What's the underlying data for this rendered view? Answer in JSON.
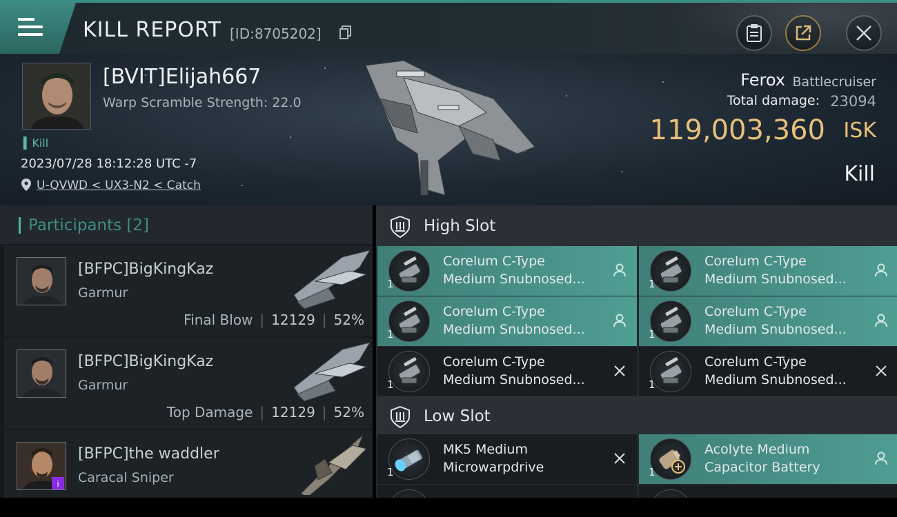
{
  "topbar": {
    "title": "KILL REPORT",
    "report_id": "[ID:8705202]",
    "icons": [
      "menu-icon",
      "clipboard-icon",
      "share-icon",
      "close-icon"
    ]
  },
  "victim": {
    "name": "[BVIT]Elijah667",
    "warp_scramble": "Warp Scramble Strength: 22.0",
    "tag": "Kill",
    "datetime": "2023/07/28 18:12:28 UTC -7",
    "location": "U-QVWD < UX3-N2 < Catch",
    "ship_name": "Ferox",
    "ship_class": "Battlecruiser",
    "total_damage_label": "Total damage:",
    "total_damage": "23094",
    "isk_value": "119,003,360",
    "isk_unit": "ISK",
    "result": "Kill"
  },
  "participants": {
    "label": "Participants",
    "count": "[2]",
    "rows": [
      {
        "name": "[BFPC]BigKingKaz",
        "ship": "Garmur",
        "role": "Final Blow",
        "damage": "12129",
        "percent": "52%"
      },
      {
        "name": "[BFPC]BigKingKaz",
        "ship": "Garmur",
        "role": "Top Damage",
        "damage": "12129",
        "percent": "52%"
      },
      {
        "name": "[BFPC]the waddler",
        "ship": "Caracal Sniper"
      }
    ]
  },
  "high_slot": {
    "label": "High Slot",
    "modules": [
      {
        "line1": "Corelum C-Type",
        "line2": "Medium Snubnosed...",
        "qty": "1",
        "status": "fitted"
      },
      {
        "line1": "Corelum C-Type",
        "line2": "Medium Snubnosed...",
        "qty": "1",
        "status": "fitted"
      },
      {
        "line1": "Corelum C-Type",
        "line2": "Medium Snubnosed...",
        "qty": "1",
        "status": "fitted"
      },
      {
        "line1": "Corelum C-Type",
        "line2": "Medium Snubnosed...",
        "qty": "1",
        "status": "fitted"
      },
      {
        "line1": "Corelum C-Type",
        "line2": "Medium Snubnosed...",
        "qty": "1",
        "status": "destroyed"
      },
      {
        "line1": "Corelum C-Type",
        "line2": "Medium Snubnosed...",
        "qty": "1",
        "status": "destroyed"
      }
    ]
  },
  "low_slot": {
    "label": "Low Slot",
    "modules": [
      {
        "line1": "MK5 Medium",
        "line2": "Microwarpdrive",
        "qty": "1",
        "status": "destroyed"
      },
      {
        "line1": "Acolyte Medium",
        "line2": "Capacitor Battery",
        "qty": "1",
        "status": "fitted"
      }
    ]
  },
  "colors": {
    "accent": "#4cb3a3",
    "isk": "#e7c07a",
    "fitted_bg": "#4f9d93"
  }
}
